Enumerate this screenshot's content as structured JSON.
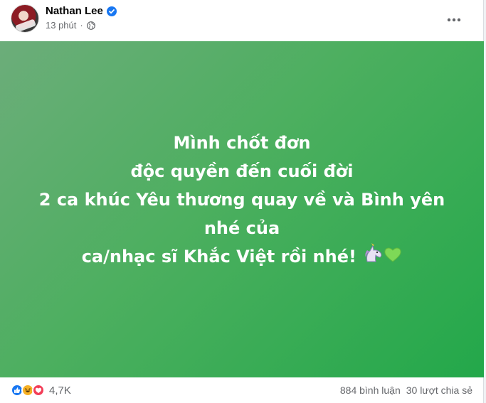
{
  "post": {
    "author": "Nathan Lee",
    "time": "13 phút",
    "separator": "·",
    "text_lines": [
      "Mình chốt đơn",
      "độc quyền đến cuối đời",
      "2 ca khúc Yêu thương quay về và Bình yên",
      "nhé của",
      "ca/nhạc sĩ Khắc Việt rồi nhé!"
    ],
    "emojis": [
      "unicorn-emoji",
      "green-heart-emoji"
    ],
    "background": {
      "from": "#6cad7a",
      "to": "#23a84a"
    }
  },
  "footer": {
    "reaction_count": "4,7K",
    "comments": "884 bình luận",
    "shares": "30 lượt chia sẻ",
    "reactions": [
      "like-icon",
      "haha-icon",
      "love-icon"
    ]
  },
  "icons": {
    "verified": "verified-badge-icon",
    "audience": "globe-icon",
    "menu": "more-options-icon"
  },
  "colors": {
    "like": "#1877f2",
    "love": "#f33e58",
    "haha": "#f7b125",
    "verified": "#1877f2",
    "secondary_text": "#65676b"
  }
}
